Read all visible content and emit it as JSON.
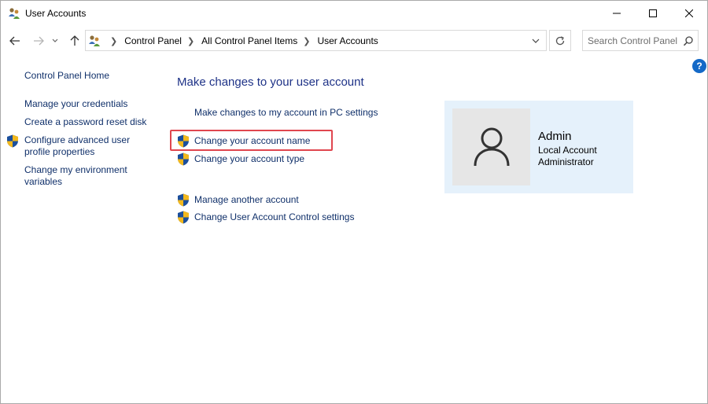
{
  "window": {
    "title": "User Accounts",
    "minimize_icon": "minimize-icon",
    "maximize_icon": "maximize-icon",
    "close_icon": "close-icon"
  },
  "address": {
    "breadcrumbs": [
      "Control Panel",
      "All Control Panel Items",
      "User Accounts"
    ],
    "search_placeholder": "Search Control Panel"
  },
  "help": {
    "label": "?"
  },
  "sidebar": {
    "home": "Control Panel Home",
    "items": [
      {
        "label": "Manage your credentials",
        "shield": false
      },
      {
        "label": "Create a password reset disk",
        "shield": false
      },
      {
        "label_line1": "Configure advanced user",
        "label_line2": "profile properties",
        "shield": true
      },
      {
        "label_line1": "Change my environment",
        "label_line2": "variables",
        "shield": false
      }
    ]
  },
  "main": {
    "heading": "Make changes to your user account",
    "tasks": [
      {
        "label": "Make changes to my account in PC settings",
        "shield": false
      },
      {
        "label": "Change your account name",
        "shield": true,
        "highlighted": true
      },
      {
        "label": "Change your account type",
        "shield": true
      },
      {
        "label": "Manage another account",
        "shield": true
      },
      {
        "label": "Change User Account Control settings",
        "shield": true
      }
    ]
  },
  "account": {
    "name": "Admin",
    "type": "Local Account",
    "role": "Administrator",
    "avatar_icon": "user-silhouette-icon"
  },
  "colors": {
    "link": "#10306a",
    "heading": "#1e3287",
    "card_bg": "#e5f1fb",
    "highlight_border": "#e0464f",
    "help_bg": "#1469c7"
  }
}
